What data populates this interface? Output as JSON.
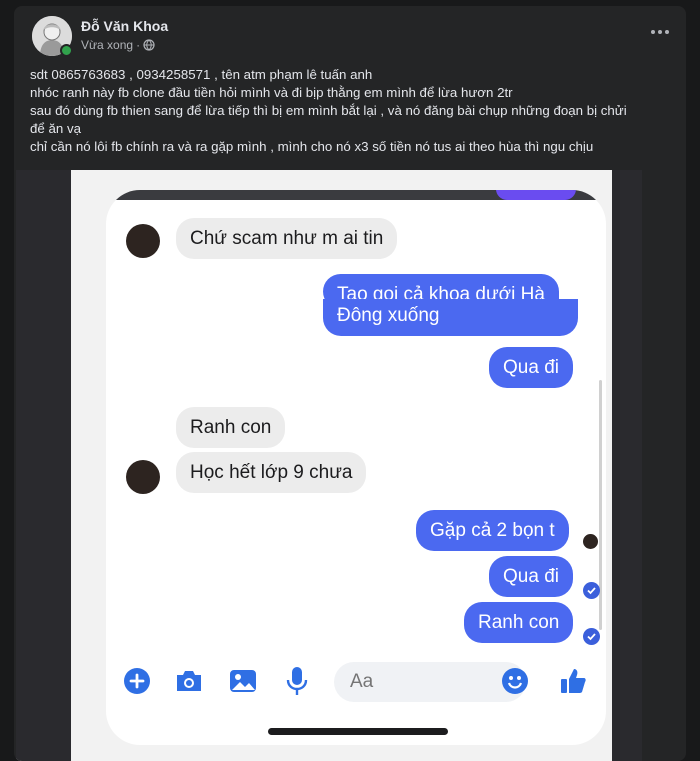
{
  "post": {
    "author": "Đỗ Văn Khoa",
    "time": "Vừa xong",
    "separator": "·",
    "lines": [
      "sdt 0865763683 ,  0934258571 , tên atm phạm lê tuấn anh",
      "nhóc ranh này fb clone đầu tiền hỏi mình và đi bịp thằng em mình để lừa hươn 2tr",
      "sau đó dùng fb thien sang  để lừa tiếp thì bị em mình bắt lại , và nó đăng bài chụp những đoạn bị chửi",
      "để ăn vạ",
      "chỉ cần nó lôi fb chính ra và ra gặp mình , mình cho nó x3 số tiền nó tus ai theo hùa thì ngu chịu"
    ]
  },
  "chat": {
    "messages": [
      {
        "dir": "in",
        "text": "Chứ scam như m ai tin"
      },
      {
        "dir": "out",
        "text": "Tao gọi cả khoa dưới Hà"
      },
      {
        "dir": "out",
        "text": "Đông xuống"
      },
      {
        "dir": "out",
        "text": "Qua đi"
      },
      {
        "dir": "in",
        "text": "Ranh con"
      },
      {
        "dir": "in",
        "text": "Học hết lớp 9 chưa"
      },
      {
        "dir": "out",
        "text": "Gặp cả 2 bọn t"
      },
      {
        "dir": "out",
        "text": "Qua đi"
      },
      {
        "dir": "out",
        "text": "Ranh con"
      }
    ],
    "input_placeholder": "Aa"
  },
  "colors": {
    "background": "#18191a",
    "card": "#242526",
    "text": "#e4e6eb",
    "muted": "#b0b3b8",
    "online": "#31a24c",
    "messenger_blue": "#4b69f0",
    "incoming_bubble": "#ececec"
  },
  "icons": [
    "globe-icon",
    "more-options-icon",
    "plus-icon",
    "camera-icon",
    "gallery-icon",
    "microphone-icon",
    "emoji-icon",
    "like-icon",
    "seen-check-icon"
  ]
}
